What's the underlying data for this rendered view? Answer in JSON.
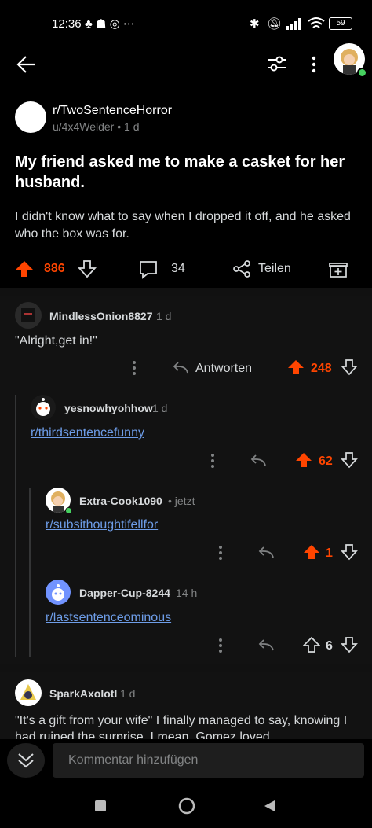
{
  "status": {
    "time": "12:36",
    "battery": "59"
  },
  "post": {
    "subreddit": "r/TwoSentenceHorror",
    "meta": "u/4x4Welder • 1 d",
    "title": "My friend asked me to make a casket for her husband.",
    "body": "I didn't know what to say when I dropped it off, and he asked who the box was for.",
    "upvotes": "886",
    "comments": "34",
    "share_label": "Teilen"
  },
  "comments": [
    {
      "user": "MindlessOnion8827",
      "time": "1 d",
      "text": "\"Alright,get in!\"",
      "reply_label": "Antworten",
      "votes": "248"
    },
    {
      "user": "yesnowhyohhow",
      "time": "1 d",
      "link": "r/thirdsentencefunny",
      "votes": "62"
    },
    {
      "user": "Extra-Cook1090",
      "time": "• jetzt",
      "link": "r/subsithoughtifellfor",
      "votes": "1"
    },
    {
      "user": "Dapper-Cup-8244",
      "time": "14 h",
      "link": "r/lastsentenceominous",
      "votes": "6"
    },
    {
      "user": "SparkAxolotl",
      "time": "1 d",
      "text": "\"It's a gift from your wife\" I finally managed to say, knowing I had ruined the surprise. I mean, Gomez loved"
    }
  ],
  "input": {
    "placeholder": "Kommentar hinzufügen"
  },
  "colors": {
    "accent": "#ff4500",
    "link": "#6e9de8",
    "bg": "#000000",
    "comment_bg": "#121212"
  }
}
